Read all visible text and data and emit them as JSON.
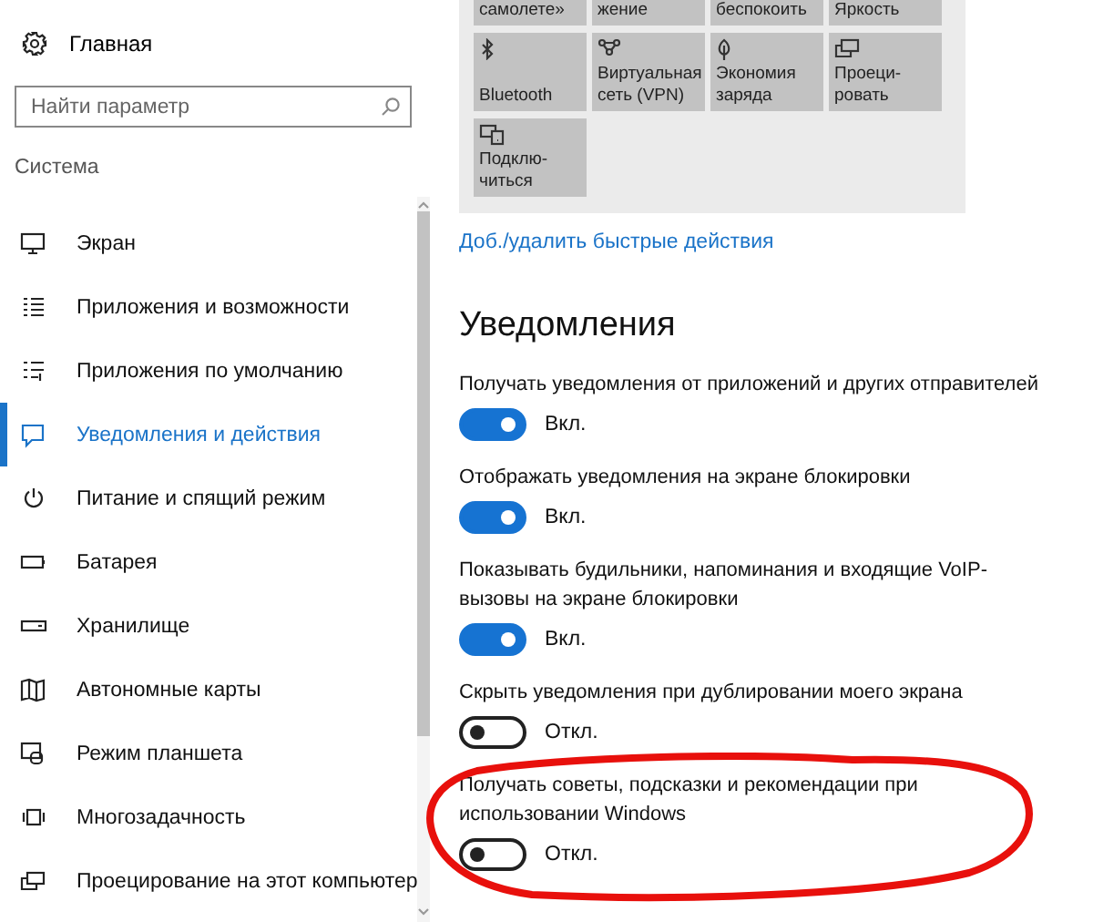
{
  "sidebar": {
    "home": {
      "label": "Главная"
    },
    "search": {
      "placeholder": "Найти параметр"
    },
    "section": "Система",
    "items": [
      {
        "label": "Экран",
        "selected": false
      },
      {
        "label": "Приложения и возможности",
        "selected": false
      },
      {
        "label": "Приложения по умолчанию",
        "selected": false
      },
      {
        "label": "Уведомления и действия",
        "selected": true
      },
      {
        "label": "Питание и спящий режим",
        "selected": false
      },
      {
        "label": "Батарея",
        "selected": false
      },
      {
        "label": "Хранилище",
        "selected": false
      },
      {
        "label": "Автономные карты",
        "selected": false
      },
      {
        "label": "Режим планшета",
        "selected": false
      },
      {
        "label": "Многозадачность",
        "selected": false
      },
      {
        "label": "Проецирование на этот компьютер",
        "selected": false
      }
    ]
  },
  "quick_actions": {
    "tiles": [
      {
        "label": "самолете»"
      },
      {
        "label": "жение"
      },
      {
        "label": "беспокоить"
      },
      {
        "label": "Яркость"
      },
      {
        "label": "Bluetooth"
      },
      {
        "label": "Виртуальная сеть (VPN)"
      },
      {
        "label": "Экономия заряда"
      },
      {
        "label": "Проеци-ровать"
      },
      {
        "label": "Подклю-читься"
      }
    ],
    "link": "Доб./удалить быстрые действия"
  },
  "notifications": {
    "heading": "Уведомления",
    "settings": [
      {
        "label": "Получать уведомления от приложений и других отправителей",
        "on": true,
        "state_text": "Вкл."
      },
      {
        "label": "Отображать уведомления на экране блокировки",
        "on": true,
        "state_text": "Вкл."
      },
      {
        "label": "Показывать будильники, напоминания и входящие VoIP-вызовы на экране блокировки",
        "on": true,
        "state_text": "Вкл."
      },
      {
        "label": "Скрыть уведомления при дублировании моего экрана",
        "on": false,
        "state_text": "Откл."
      },
      {
        "label": "Получать советы, подсказки и рекомендации при использовании Windows",
        "on": false,
        "state_text": "Откл."
      }
    ]
  }
}
